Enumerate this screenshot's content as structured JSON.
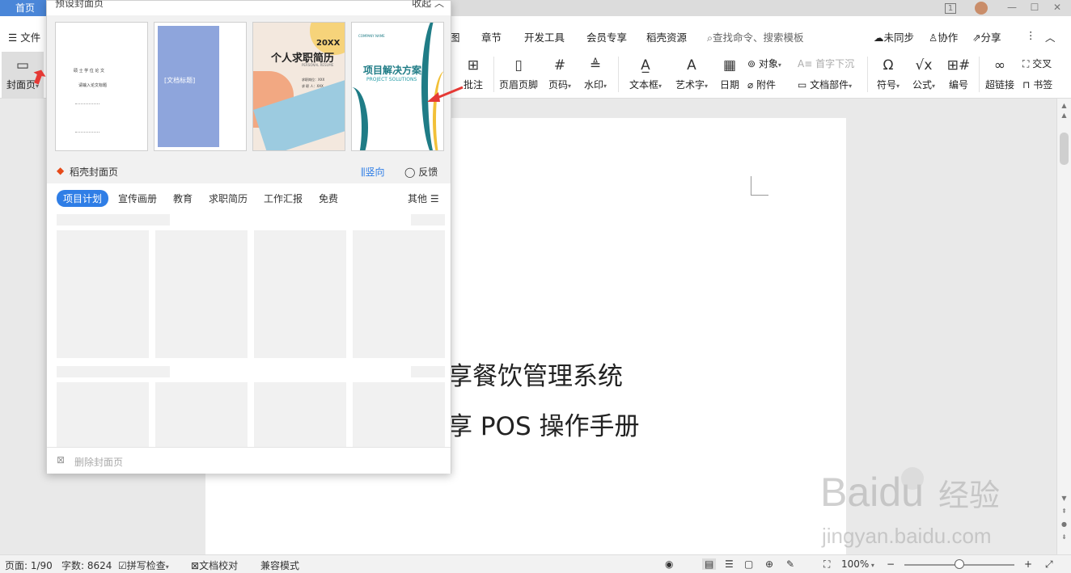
{
  "titlebar": {
    "home_tab": "首页",
    "page_badge": "1"
  },
  "menubar": {
    "file": "文件",
    "tabs": [
      "图",
      "章节",
      "开发工具",
      "会员专享",
      "稻壳资源"
    ],
    "search": "查找命令、搜索模板",
    "right": {
      "sync": "未同步",
      "collab": "协作",
      "share": "分享"
    }
  },
  "ribbon": {
    "cover": "封面页",
    "comment": "批注",
    "header_footer": "页眉页脚",
    "page_number": "页码",
    "watermark": "水印",
    "textbox": "文本框",
    "wordart": "艺术字",
    "date": "日期",
    "object": "对象",
    "attachment": "附件",
    "dropcap": "首字下沉",
    "doc_parts": "文档部件",
    "symbol": "符号",
    "formula": "公式",
    "numbering": "编号",
    "hyperlink": "超链接",
    "crossref": "交叉",
    "bookmark": "书签"
  },
  "panel": {
    "title": "预设封面页",
    "collapse": "收起",
    "templates": [
      {
        "kind": "thesis",
        "lines": [
          "硕 士 学 位 论 文",
          "请输入论文标题"
        ]
      },
      {
        "kind": "blue",
        "lines": [
          "[文档标题]"
        ]
      },
      {
        "kind": "resume",
        "lines": [
          "20XX",
          "个人求职简历",
          "PERSONAL RESUME",
          "求职岗位：XXX",
          "求 职 人：XXX"
        ]
      },
      {
        "kind": "project",
        "lines": [
          "COMPANY NAME",
          "项目解决方案",
          "PROJECT SOLUTIONS"
        ]
      }
    ],
    "daoke_title": "稻壳封面页",
    "vertical": "竖向",
    "feedback": "反馈",
    "categories": [
      "项目计划",
      "宣传画册",
      "教育",
      "求职简历",
      "工作汇报",
      "免费"
    ],
    "more": "其他",
    "delete": "删除封面页"
  },
  "document": {
    "line1": "享餐饮管理系统",
    "line2": "享 POS 操作手册"
  },
  "status": {
    "page": "页面: 1/90",
    "words": "字数: 8624",
    "spell": "拼写检查",
    "proof": "文档校对",
    "compat": "兼容模式",
    "zoom": "100%"
  },
  "watermark": {
    "brand": "Baidu",
    "brand2": "经验",
    "url": "jingyan.baidu.com"
  },
  "colors": {
    "accent": "#2f7ee6",
    "home_tab": "#4a86d8",
    "arrow": "#e53935"
  }
}
